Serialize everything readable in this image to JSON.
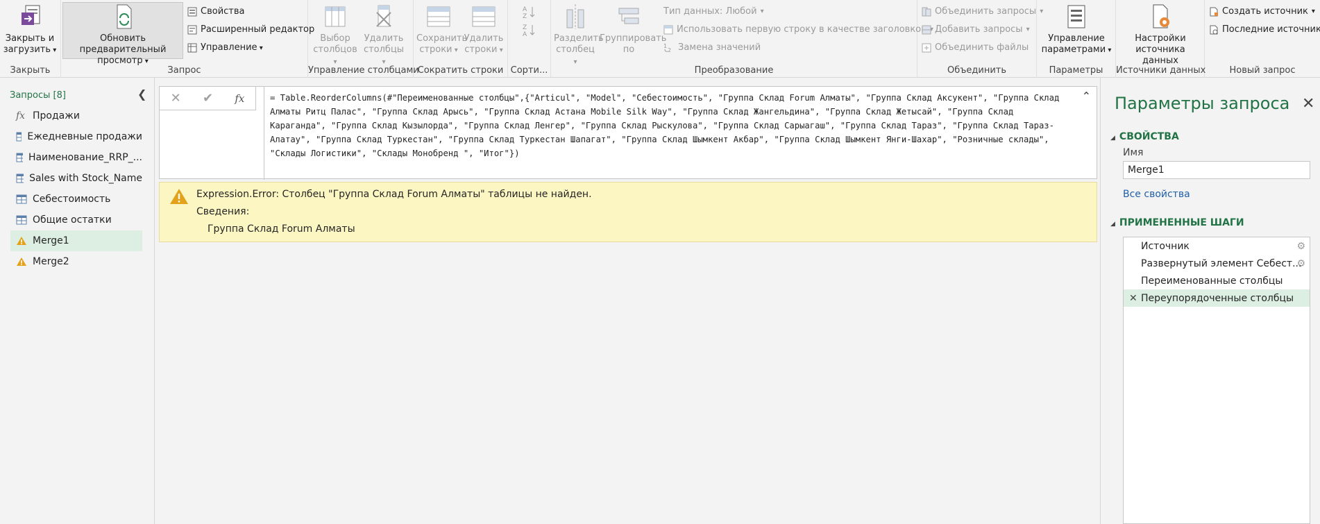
{
  "ribbon": {
    "close_load": {
      "label1": "Закрыть и",
      "label2": "загрузить"
    },
    "close_group": "Закрыть",
    "refresh": {
      "label1": "Обновить предварительный",
      "label2": "просмотр"
    },
    "properties": "Свойства",
    "advanced_editor": "Расширенный редактор",
    "manage": "Управление",
    "query_group": "Запрос",
    "choose_columns": {
      "label1": "Выбор",
      "label2": "столбцов"
    },
    "remove_columns": {
      "label1": "Удалить",
      "label2": "столбцы"
    },
    "manage_columns_group": "Управление столбцами",
    "keep_rows": {
      "label1": "Сохранить",
      "label2": "строки"
    },
    "remove_rows": {
      "label1": "Удалить",
      "label2": "строки"
    },
    "reduce_rows_group": "Сократить строки",
    "sort_group": "Сорти...",
    "split_column": {
      "label1": "Разделить",
      "label2": "столбец"
    },
    "group_by": {
      "label1": "Группировать",
      "label2": "по"
    },
    "data_type": "Тип данных: Любой",
    "first_row_headers": "Использовать первую строку в качестве заголовков",
    "replace_values": "Замена значений",
    "transform_group": "Преобразование",
    "merge_queries": "Объединить запросы",
    "append_queries": "Добавить запросы",
    "combine_files": "Объединить файлы",
    "combine_group": "Объединить",
    "manage_params": {
      "label1": "Управление",
      "label2": "параметрами"
    },
    "params_group": "Параметры",
    "data_source_settings": {
      "label1": "Настройки",
      "label2": "источника данных"
    },
    "data_sources_group": "Источники данных",
    "new_source": "Создать источник",
    "recent_sources": "Последние источники",
    "new_query_group": "Новый запрос"
  },
  "queries": {
    "title": "Запросы [8]",
    "items": [
      {
        "label": "Продажи",
        "icon": "fx"
      },
      {
        "label": "Ежедневные продажи",
        "icon": "table"
      },
      {
        "label": "Наименование_RRP_...",
        "icon": "table"
      },
      {
        "label": "Sales with Stock_Name",
        "icon": "table"
      },
      {
        "label": "Себестоимость",
        "icon": "table"
      },
      {
        "label": "Общие остатки",
        "icon": "table"
      },
      {
        "label": "Merge1",
        "icon": "warning"
      },
      {
        "label": "Merge2",
        "icon": "warning"
      }
    ]
  },
  "formula": {
    "fx": "fx",
    "text": "= Table.ReorderColumns(#\"Переименованные столбцы\",{\"Articul\", \"Model\", \"Себестоимость\", \"Группа Склад Forum Алматы\", \"Группа Склад Аксукент\", \"Группа Склад Алматы Ритц Палас\", \"Группа Склад Арысь\", \"Группа Склад Астана Mobile Silk Way\", \"Группа Склад Жангельдина\", \"Группа Склад Жетысай\", \"Группа Склад Караганда\", \"Группа Склад Кызылорда\", \"Группа Склад Ленгер\", \"Группа Склад Рыскулова\", \"Группа Склад Сарыагаш\", \"Группа Склад Тараз\", \"Группа Склад Тараз-Алатау\", \"Группа Склад Туркестан\", \"Группа Склад Туркестан Шапагат\", \"Группа Склад Шымкент Акбар\", \"Группа Склад Шымкент Янги-Шахар\", \"Розничные склады\", \"Склады Логистики\", \"Склады Монобренд \", \"Итог\"})"
  },
  "error": {
    "message": "Expression.Error: Столбец \"Группа Склад Forum Алматы\" таблицы не найден.",
    "details_label": "Сведения:",
    "details_value": "Группа Склад Forum Алматы"
  },
  "settings": {
    "title": "Параметры запроса",
    "properties_head": "СВОЙСТВА",
    "name_label": "Имя",
    "name_value": "Merge1",
    "all_properties": "Все свойства",
    "steps_head": "ПРИМЕНЕННЫЕ ШАГИ",
    "steps": [
      {
        "label": "Источник",
        "gear": true
      },
      {
        "label": "Развернутый элемент Себест...",
        "gear": true
      },
      {
        "label": "Переименованные столбцы",
        "gear": false
      },
      {
        "label": "Переупорядоченные столбцы",
        "gear": false
      }
    ]
  },
  "colors": {
    "accent": "#217346",
    "active_bg": "#dcefe2",
    "error_bg": "#fcf6c2"
  }
}
